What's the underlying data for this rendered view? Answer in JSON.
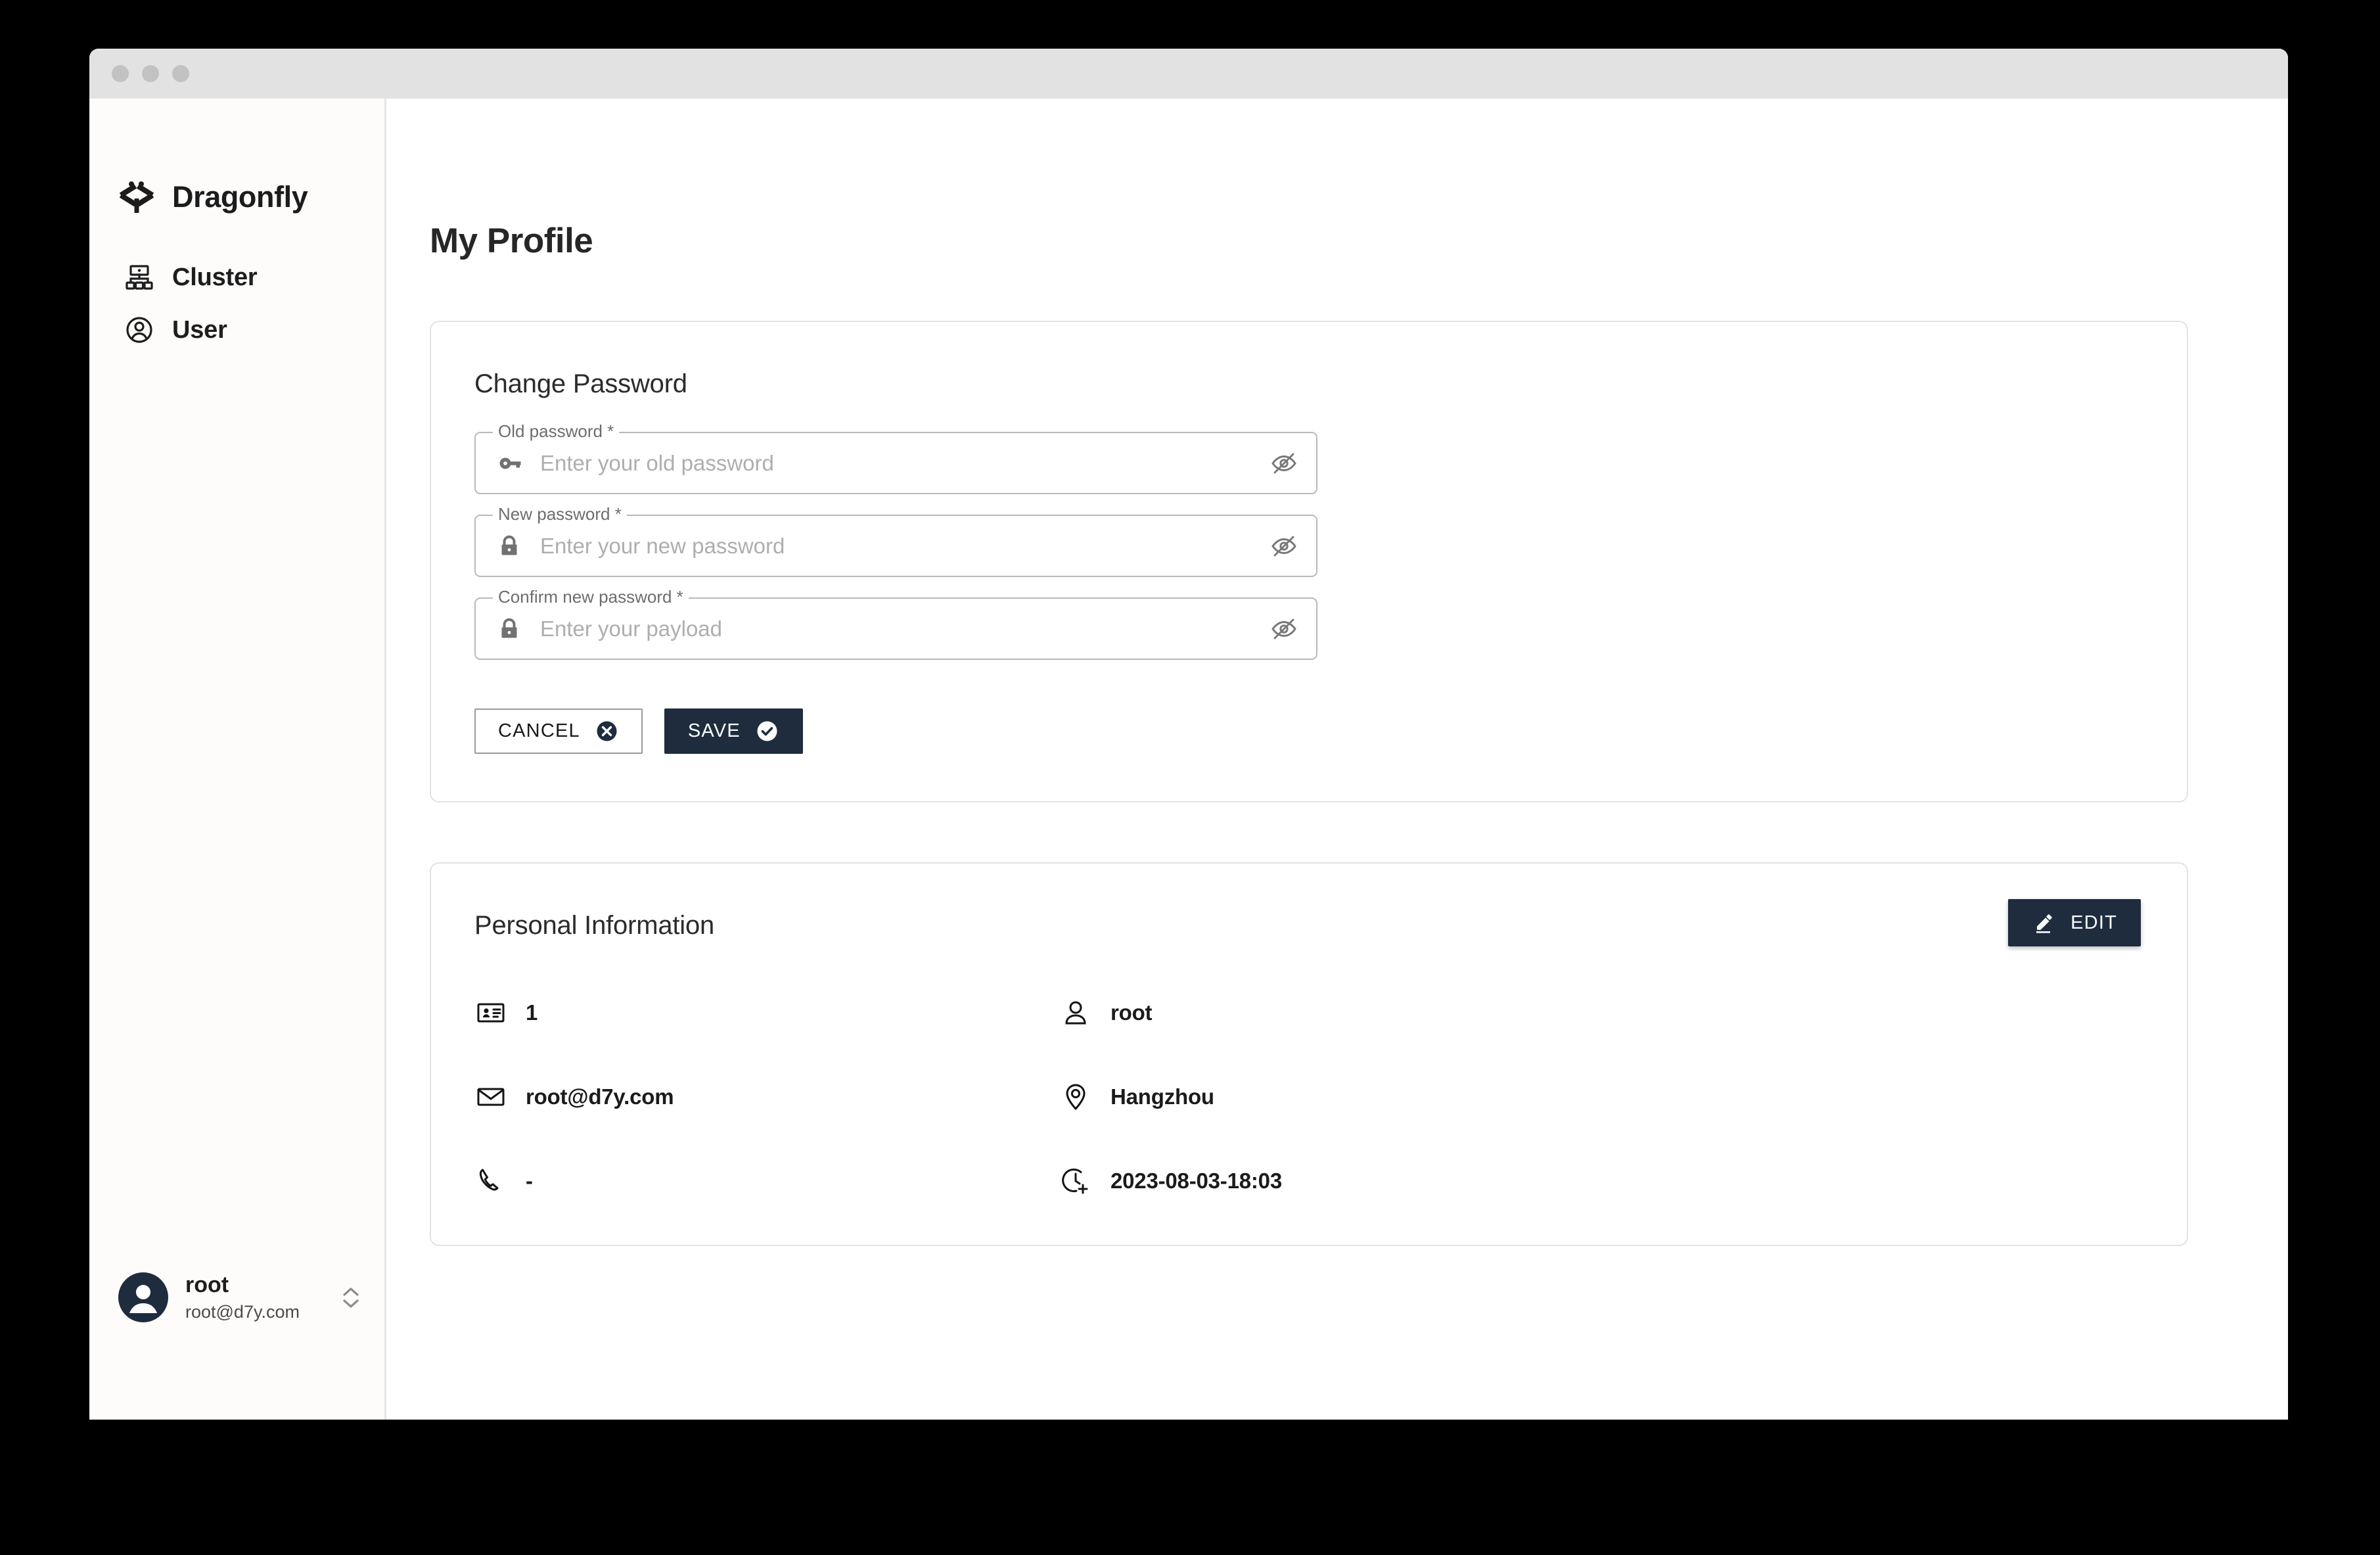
{
  "window": {
    "traffic_lights": [
      "close",
      "minimize",
      "maximize"
    ]
  },
  "sidebar": {
    "brand": {
      "name": "Dragonfly",
      "icon": "dragonfly-logo-icon"
    },
    "items": [
      {
        "label": "Cluster",
        "icon": "cluster-icon"
      },
      {
        "label": "User",
        "icon": "user-circle-icon"
      }
    ],
    "user": {
      "name": "root",
      "email": "root@d7y.com",
      "avatar_icon": "person-avatar-icon",
      "expander_icon": "unfold-more-icon"
    }
  },
  "main": {
    "page_title": "My Profile",
    "change_password": {
      "title": "Change Password",
      "fields": [
        {
          "label": "Old password *",
          "placeholder": "Enter your old password",
          "value": "",
          "lead_icon": "key-icon",
          "trail_icon": "visibility-off-icon"
        },
        {
          "label": "New password *",
          "placeholder": "Enter your new password",
          "value": "",
          "lead_icon": "lock-icon",
          "trail_icon": "visibility-off-icon"
        },
        {
          "label": "Confirm new password *",
          "placeholder": "Enter your payload",
          "value": "",
          "lead_icon": "lock-icon",
          "trail_icon": "visibility-off-icon"
        }
      ],
      "cancel_label": "CANCEL",
      "cancel_icon": "cancel-circle-icon",
      "save_label": "SAVE",
      "save_icon": "check-circle-icon"
    },
    "personal_information": {
      "title": "Personal Information",
      "edit_label": "EDIT",
      "edit_icon": "pencil-icon",
      "rows": [
        {
          "icon": "id-badge-icon",
          "value": "1"
        },
        {
          "icon": "person-icon",
          "value": "root"
        },
        {
          "icon": "email-icon",
          "value": "root@d7y.com"
        },
        {
          "icon": "location-pin-icon",
          "value": "Hangzhou"
        },
        {
          "icon": "phone-icon",
          "value": "-"
        },
        {
          "icon": "more-time-icon",
          "value": "2023-08-03-18:03"
        }
      ]
    }
  },
  "colors": {
    "accent_dark": "#1e2c3e",
    "sidebar_bg": "#fdfcfa",
    "card_border": "#e3e3e3",
    "field_border": "#b9b9b9",
    "placeholder": "#aeaeae"
  }
}
